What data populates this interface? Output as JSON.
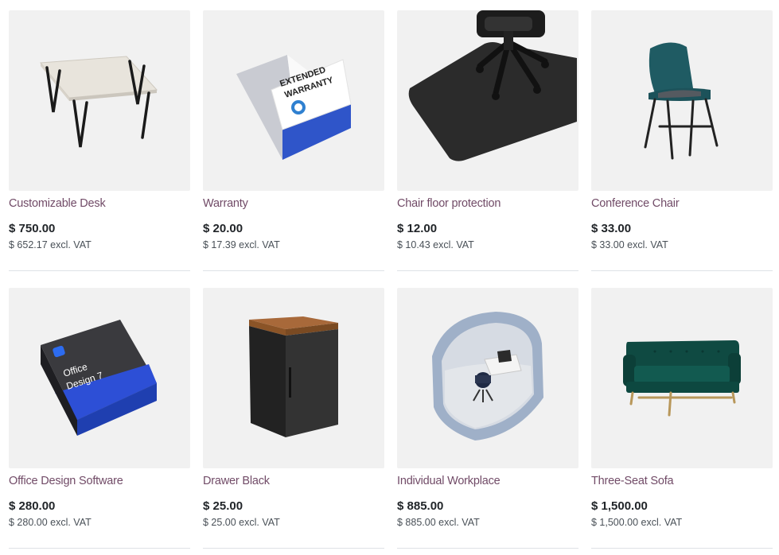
{
  "colors": {
    "accent": "#714b67",
    "text": "#212529",
    "muted": "#495057",
    "thumb_bg": "#f1f1f1"
  },
  "products": [
    {
      "name": "Customizable Desk",
      "price": "$ 750.00",
      "excl": "$ 652.17 excl. VAT",
      "image": "desk-image"
    },
    {
      "name": "Warranty",
      "price": "$ 20.00",
      "excl": "$ 17.39 excl. VAT",
      "image": "warranty-box-image",
      "image_text": [
        "EXTENDED",
        "WARRANTY"
      ]
    },
    {
      "name": "Chair floor protection",
      "price": "$ 12.00",
      "excl": "$ 10.43 excl. VAT",
      "image": "floor-mat-image"
    },
    {
      "name": "Conference Chair",
      "price": "$ 33.00",
      "excl": "$ 33.00 excl. VAT",
      "image": "chair-image"
    },
    {
      "name": "Office Design Software",
      "price": "$ 280.00",
      "excl": "$ 280.00 excl. VAT",
      "image": "software-box-image",
      "image_text": [
        "Office",
        "Design 7"
      ]
    },
    {
      "name": "Drawer Black",
      "price": "$ 25.00",
      "excl": "$ 25.00 excl. VAT",
      "image": "drawer-image"
    },
    {
      "name": "Individual Workplace",
      "price": "$ 885.00",
      "excl": "$ 885.00 excl. VAT",
      "image": "workpod-image"
    },
    {
      "name": "Three-Seat Sofa",
      "price": "$ 1,500.00",
      "excl": "$ 1,500.00 excl. VAT",
      "image": "sofa-image"
    }
  ]
}
